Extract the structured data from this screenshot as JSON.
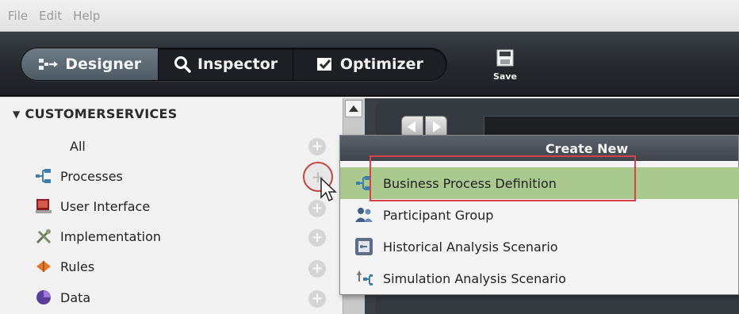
{
  "menubar": {
    "items": [
      "File",
      "Edit",
      "Help"
    ]
  },
  "toolbar": {
    "modes": [
      {
        "label": "Designer",
        "icon": "designer-icon",
        "active": true
      },
      {
        "label": "Inspector",
        "icon": "magnifier-icon",
        "active": false
      },
      {
        "label": "Optimizer",
        "icon": "checkbox-icon",
        "active": false
      }
    ],
    "save_label": "Save",
    "active_color": "#5a6873"
  },
  "sidebar": {
    "title": "CUSTOMERSERVICES",
    "items": [
      {
        "label": "All",
        "icon": ""
      },
      {
        "label": "Processes",
        "icon": "process-icon"
      },
      {
        "label": "User Interface",
        "icon": "user-interface-icon"
      },
      {
        "label": "Implementation",
        "icon": "implementation-icon"
      },
      {
        "label": "Rules",
        "icon": "rules-icon"
      },
      {
        "label": "Data",
        "icon": "data-icon"
      }
    ]
  },
  "popup": {
    "title": "Create New",
    "items": [
      {
        "label": "Business Process Definition",
        "icon": "process-icon",
        "selected": true
      },
      {
        "label": "Participant Group",
        "icon": "participant-group-icon",
        "selected": false
      },
      {
        "label": "Historical Analysis Scenario",
        "icon": "historical-scenario-icon",
        "selected": false
      },
      {
        "label": "Simulation Analysis Scenario",
        "icon": "simulation-scenario-icon",
        "selected": false
      }
    ],
    "selected_color": "#a9c98f",
    "highlight_color": "#d9414a"
  }
}
